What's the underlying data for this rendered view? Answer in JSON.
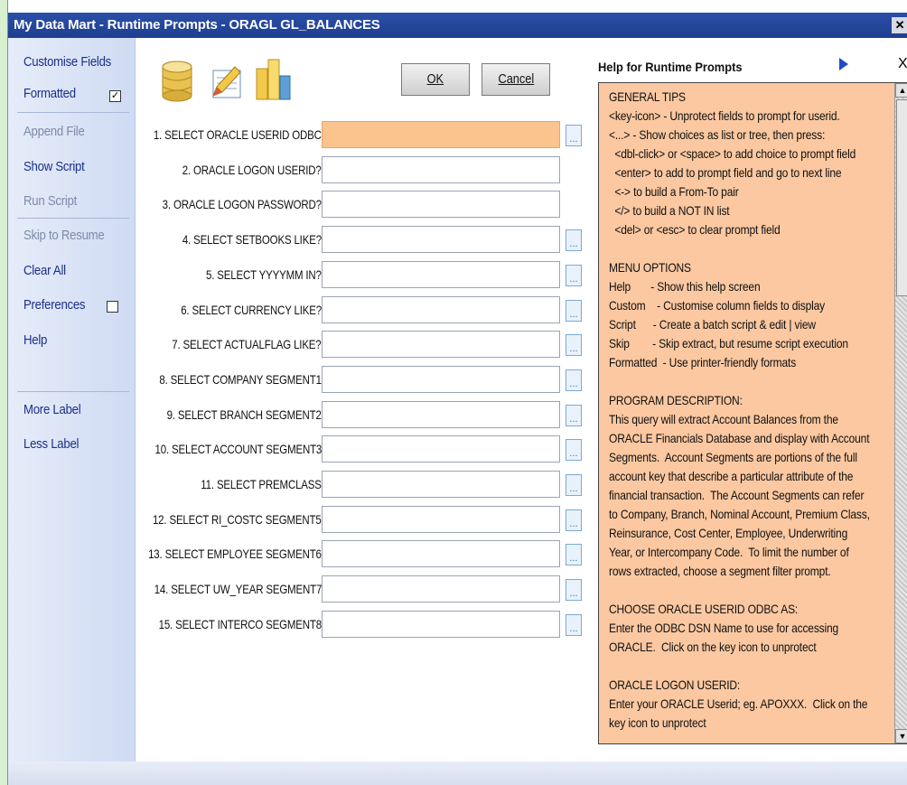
{
  "window": {
    "title": "My Data Mart - Runtime Prompts - ORAGL GL_BALANCES"
  },
  "sidebar": {
    "items": [
      {
        "label": "Customise Fields"
      },
      {
        "label": "Formatted",
        "checked": true
      },
      {
        "label": "Append File",
        "disabled": true
      },
      {
        "label": "Show Script"
      },
      {
        "label": "Run Script",
        "disabled": true
      },
      {
        "label": "Skip to Resume",
        "disabled": true
      },
      {
        "label": "Clear All"
      },
      {
        "label": "Preferences",
        "checked": false
      },
      {
        "label": "Help"
      },
      {
        "label": "More Label"
      },
      {
        "label": "Less Label"
      }
    ]
  },
  "toolbar": {
    "ok_label": "OK",
    "cancel_label": "Cancel",
    "icons": [
      "database-icon",
      "edit-document-icon",
      "chart-icon"
    ]
  },
  "prompts": [
    {
      "label": "1. SELECT ORACLE USERID ODBC",
      "value": "",
      "active": true,
      "has_list": true
    },
    {
      "label": "2. ORACLE LOGON USERID?",
      "value": "",
      "has_list": false
    },
    {
      "label": "3. ORACLE LOGON PASSWORD?",
      "value": "",
      "has_list": false
    },
    {
      "label": "4. SELECT SETBOOKS LIKE?",
      "value": "",
      "has_list": true
    },
    {
      "label": "5. SELECT YYYYMM IN?",
      "value": "",
      "has_list": true
    },
    {
      "label": "6. SELECT CURRENCY LIKE?",
      "value": "",
      "has_list": true
    },
    {
      "label": "7. SELECT ACTUALFLAG LIKE?",
      "value": "",
      "has_list": true
    },
    {
      "label": "8. SELECT COMPANY SEGMENT1",
      "value": "",
      "has_list": true
    },
    {
      "label": "9. SELECT BRANCH SEGMENT2",
      "value": "",
      "has_list": true
    },
    {
      "label": "10. SELECT ACCOUNT SEGMENT3",
      "value": "",
      "has_list": true
    },
    {
      "label": "11. SELECT PREMCLASS",
      "value": "",
      "has_list": true
    },
    {
      "label": "12. SELECT RI_COSTC SEGMENT5",
      "value": "",
      "has_list": true
    },
    {
      "label": "13. SELECT EMPLOYEE SEGMENT6",
      "value": "",
      "has_list": true
    },
    {
      "label": "14. SELECT UW_YEAR SEGMENT7",
      "value": "",
      "has_list": true
    },
    {
      "label": "15. SELECT INTERCO SEGMENT8",
      "value": "",
      "has_list": true
    }
  ],
  "help": {
    "title": "Help for Runtime Prompts",
    "close_label": "X",
    "text": "GENERAL TIPS\n<key-icon> - Unprotect fields to prompt for userid.\n<...> - Show choices as list or tree, then press:\n  <dbl-click> or <space> to add choice to prompt field\n  <enter> to add to prompt field and go to next line\n  <-> to build a From-To pair\n  </> to build a NOT IN list\n  <del> or <esc> to clear prompt field\n\nMENU OPTIONS\nHelp       - Show this help screen\nCustom    - Customise column fields to display\nScript      - Create a batch script & edit | view\nSkip        - Skip extract, but resume script execution\nFormatted  - Use printer-friendly formats\n\nPROGRAM DESCRIPTION:\nThis query will extract Account Balances from the\nORACLE Financials Database and display with Account\nSegments.  Account Segments are portions of the full\naccount key that describe a particular attribute of the\nfinancial transaction.  The Account Segments can refer\nto Company, Branch, Nominal Account, Premium Class,\nReinsurance, Cost Center, Employee, Underwriting\nYear, or Intercompany Code.  To limit the number of\nrows extracted, choose a segment filter prompt.\n\nCHOOSE ORACLE USERID ODBC AS:\nEnter the ODBC DSN Name to use for accessing\nORACLE.  Click on the key icon to unprotect\n\nORACLE LOGON USERID:\nEnter your ORACLE Userid; eg. APOXXX.  Click on the\nkey icon to unprotect"
  },
  "colors": {
    "title_bar": "#1f3f8f",
    "active_input": "#fbc38d",
    "help_background": "#fbc8a1",
    "nav_text": "#1b2f8a"
  }
}
